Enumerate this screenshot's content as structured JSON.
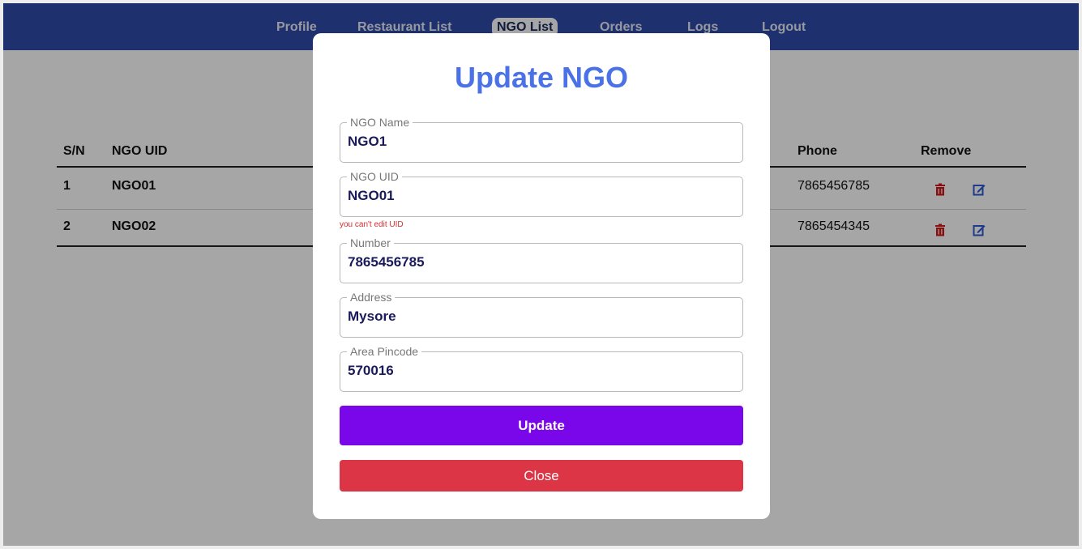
{
  "nav": {
    "items": [
      {
        "label": "Profile"
      },
      {
        "label": "Restaurant List"
      },
      {
        "label": "NGO List"
      },
      {
        "label": "Orders"
      },
      {
        "label": "Logs"
      },
      {
        "label": "Logout"
      }
    ],
    "active": "NGO List"
  },
  "table": {
    "headers": {
      "sn": "S/N",
      "uid": "NGO UID",
      "phone": "Phone",
      "remove": "Remove"
    },
    "rows": [
      {
        "sn": "1",
        "uid": "NGO01",
        "phone": "7865456785",
        "delete_icon": "trash-icon",
        "edit_icon": "edit-icon"
      },
      {
        "sn": "2",
        "uid": "NGO02",
        "phone": "7865454345",
        "delete_icon": "trash-icon",
        "edit_icon": "edit-icon"
      }
    ]
  },
  "modal": {
    "title": "Update NGO",
    "fields": {
      "name": {
        "label": "NGO Name",
        "value": "NGO1"
      },
      "uid": {
        "label": "NGO UID",
        "value": "NGO01",
        "hint": "you can't edit UID"
      },
      "number": {
        "label": "Number",
        "value": "7865456785"
      },
      "address": {
        "label": "Address",
        "value": "Mysore"
      },
      "pincode": {
        "label": "Area Pincode",
        "value": "570016"
      }
    },
    "update_label": "Update",
    "close_label": "Close"
  },
  "colors": {
    "navbar": "#2f4aa8",
    "title": "#4a72e6",
    "update_button": "#7a07ea",
    "close_button": "#dc3545",
    "icon_delete": "#d01818",
    "icon_edit": "#2f5bd6"
  }
}
